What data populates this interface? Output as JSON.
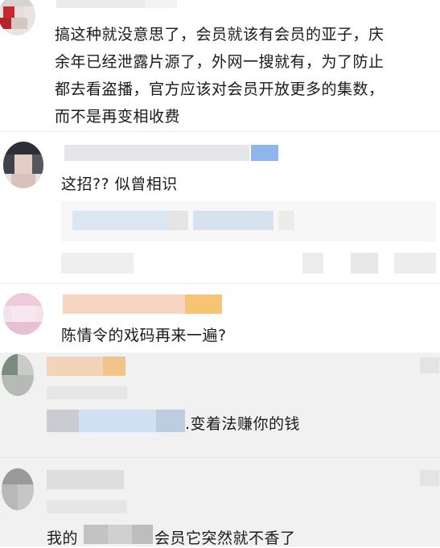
{
  "comments": [
    {
      "text_lines": [
        "搞这种就没意思了，会员就该有会员的亚子，庆",
        "余年已经泄露片源了，外网一搜就有，为了防止",
        "都去看盗播，官方应该对会员开放更多的集数，",
        "而不是再变相收费"
      ]
    },
    {
      "text": "这招?? 似曾相识"
    },
    {
      "text": "陈情令的戏码再来一遍?"
    },
    {
      "text": ".变着法赚你的钱"
    },
    {
      "text_prefix": "我的",
      "text_suffix": "会员它突然就不香了"
    }
  ]
}
